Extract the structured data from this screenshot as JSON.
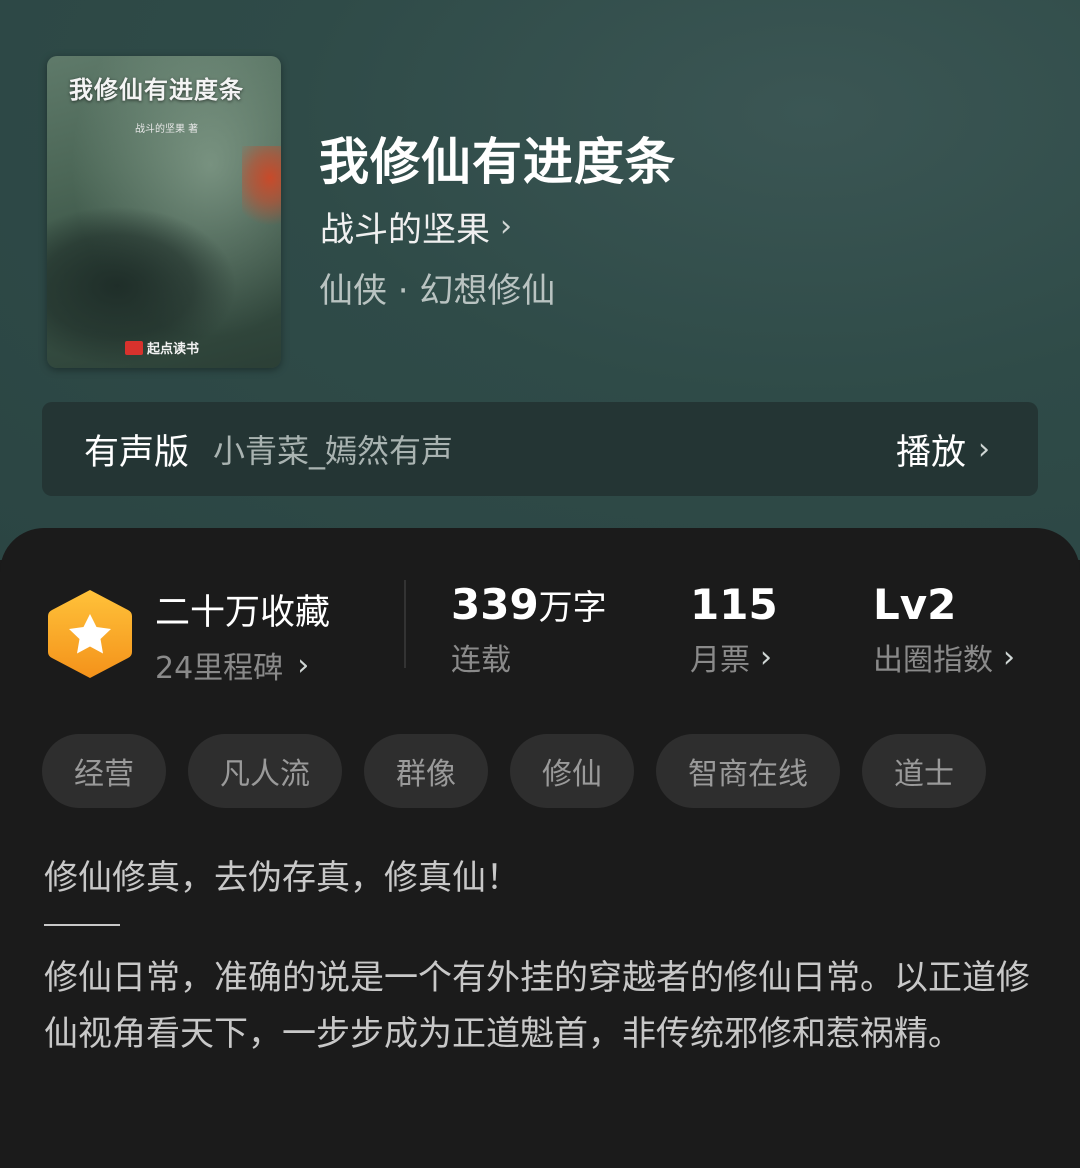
{
  "book": {
    "cover_title": "我修仙有进度条",
    "cover_author": "战斗的坚果 著",
    "cover_brand": "起点读书",
    "title": "我修仙有进度条",
    "author": "战斗的坚果",
    "genre": "仙侠 · 幻想修仙"
  },
  "audio": {
    "label": "有声版",
    "narrator": "小青菜_嫣然有声",
    "play_label": "播放"
  },
  "stats": {
    "collect_title": "二十万收藏",
    "collect_sub": "24里程碑",
    "words_value": "339",
    "words_unit": "万字",
    "words_label": "连载",
    "votes_value": "115",
    "votes_label": "月票",
    "level_value": "Lv2",
    "level_label": "出圈指数"
  },
  "tags": [
    "经营",
    "凡人流",
    "群像",
    "修仙",
    "智商在线",
    "道士"
  ],
  "description": {
    "line1": "修仙修真，去伪存真，修真仙！",
    "body": "修仙日常，准确的说是一个有外挂的穿越者的修仙日常。以正道修仙视角看天下，一步步成为正道魁首，非传统邪修和惹祸精。"
  },
  "colors": {
    "badge_orange": "#f7a21b",
    "card_bg": "#1b1b1b",
    "tag_bg": "#2e2e2e"
  }
}
